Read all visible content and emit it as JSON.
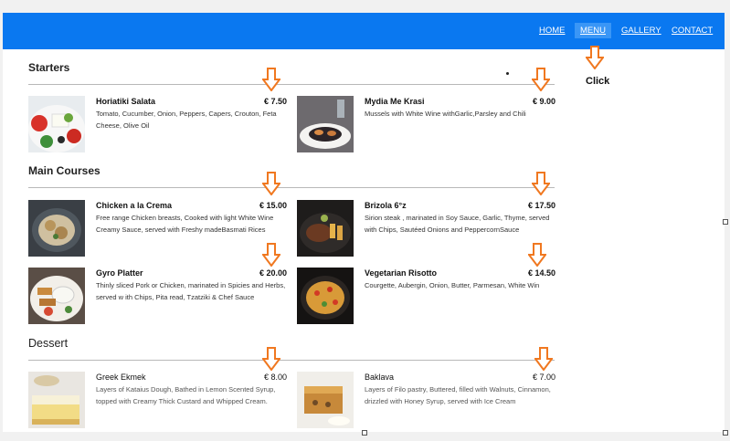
{
  "nav": {
    "home": "HOME",
    "menu": "MENU",
    "gallery": "GALLERY",
    "contact": "CONTACT"
  },
  "annotation": {
    "click_label": "Click",
    "arrow_color": "#f07820"
  },
  "colors": {
    "navbar": "#0a78f0",
    "nav_active": "#3a96f6"
  },
  "sections": {
    "starters": {
      "title": "Starters",
      "items": [
        {
          "name": "Horiatiki Salata",
          "price": "€ 7.50",
          "desc": "Tomato, Cucumber, Onion, Peppers, Capers, Crouton, Feta Cheese, Olive Oil"
        },
        {
          "name": "Mydia Me Krasi",
          "price": "€ 9.00",
          "desc": "Mussels with White Wine withGarlic,Parsley and Chili"
        }
      ]
    },
    "main": {
      "title": "Main Courses",
      "items": [
        {
          "name": "Chicken a la Crema",
          "price": "€ 15.00",
          "desc": "Free range Chicken breasts, Cooked with light White Wine Creamy Sauce, served with Freshy madeBasmati Rices"
        },
        {
          "name": "Brizola 6°z",
          "price": "€ 17.50",
          "desc": "Sirion steak , marinated in Soy Sauce, Garlic, Thyme, served with Chips, Sautéed Onions and PeppercornSauce"
        },
        {
          "name": "Gyro Platter",
          "price": "€ 20.00",
          "desc": "Thinly sliced Pork or Chicken, marinated in Spicies and Herbs, served w ith Chips, Pita read, Tzatziki & Chef Sauce"
        },
        {
          "name": "Vegetarian Risotto",
          "price": "€ 14.50",
          "desc": "Courgette, Aubergin, Onion, Butter, Parmesan, White Win"
        }
      ]
    },
    "dessert": {
      "title": "Dessert",
      "items": [
        {
          "name": "Greek Ekmek",
          "price": "€ 8.00",
          "desc": "Layers of Kataius Dough, Bathed in Lemon Scented Syrup, topped with Creamy Thick Custard and Whipped Cream."
        },
        {
          "name": "Baklava",
          "price": "€ 7.00",
          "desc": "Layers of Filo pastry, Buttered, filled with Walnuts, Cinnamon, drizzled with Honey Syrup, served with Ice Cream"
        }
      ]
    }
  }
}
